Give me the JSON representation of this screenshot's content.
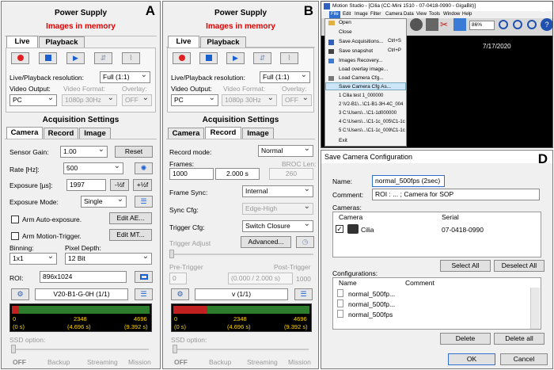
{
  "labels": {
    "a": "A",
    "b": "B",
    "c": "C",
    "d": "D"
  },
  "panel_a": {
    "title": "Power Supply",
    "images_in_memory": "Images in memory",
    "tabs": [
      "Live",
      "Playback"
    ],
    "live_playback_res_label": "Live/Playback resolution:",
    "live_playback_res": "Full (1:1)",
    "video_output_label": "Video Output:",
    "video_output": "PC",
    "video_format_label": "Video Format:",
    "video_format": "1080p 30Hz",
    "overlay_label": "Overlay:",
    "overlay": "OFF",
    "acq_title": "Acquisition Settings",
    "acq_tabs": [
      "Camera",
      "Record",
      "Image"
    ],
    "sensor_gain_label": "Sensor Gain:",
    "sensor_gain": "1.00",
    "reset": "Reset",
    "rate_label": "Rate [Hz]:",
    "rate": "500",
    "exposure_label": "Exposure [µs]:",
    "exposure": "1997",
    "half": "-½f",
    "plus_half": "+½f",
    "exposure_mode_label": "Exposure Mode:",
    "exposure_mode": "Single",
    "arm_auto": "Arm Auto-exposure.",
    "edit_ae": "Edit AE...",
    "arm_motion": "Arm Motion-Trigger.",
    "edit_mt": "Edit MT...",
    "binning_label": "Binning:",
    "binning": "1x1",
    "pixel_depth_label": "Pixel Depth:",
    "pixel_depth": "12 Bit",
    "roi_label": "ROI:",
    "roi": "896x1024",
    "camera_id": "V20-B1-G-0H (1/1)",
    "mem": {
      "start": "0",
      "mid": "2348",
      "end": "4696",
      "start_s": "(0 s)",
      "mid_s": "(4.696 s)",
      "end_s": "(9.392 s)",
      "fill": 0.05
    },
    "ssd_label": "SSD option:",
    "ssd_opts": [
      "OFF",
      "Backup",
      "Streaming",
      "Mission"
    ]
  },
  "panel_b": {
    "title": "Power Supply",
    "images_in_memory": "Images in memory",
    "tabs": [
      "Live",
      "Playback"
    ],
    "live_playback_res_label": "Live/Playback resolution:",
    "live_playback_res": "Full (1:1)",
    "video_output_label": "Video Output:",
    "video_output": "PC",
    "video_format_label": "Video Format:",
    "video_format": "1080p 30Hz",
    "overlay_label": "Overlay:",
    "overlay": "OFF",
    "acq_title": "Acquisition Settings",
    "acq_tabs": [
      "Camera",
      "Record",
      "Image"
    ],
    "record_mode_label": "Record mode:",
    "record_mode": "Normal",
    "frames_label": "Frames:",
    "frames": "1000",
    "frames_s": "2.000 s",
    "broc_label": "BROC Len:",
    "broc": "260",
    "frame_sync_label": "Frame Sync:",
    "frame_sync": "Internal",
    "sync_cfg_label": "Sync Cfg:",
    "sync_cfg": "Edge-High",
    "trigger_cfg_label": "Trigger Cfg:",
    "trigger_cfg": "Switch Closure",
    "trigger_adjust": "Trigger Adjust",
    "advanced": "Advanced...",
    "pre_trigger": "Pre-Trigger",
    "post_trigger": "Post-Trigger",
    "pre_val": "0",
    "range": "(0.000 / 2.000 s)",
    "post_val": "1000",
    "camera_id": "v (1/1)",
    "mem": {
      "start": "0",
      "mid": "2348",
      "end": "4696",
      "start_s": "(0 s)",
      "mid_s": "(4.696 s)",
      "end_s": "(9.392 s)",
      "fill": 0.25
    },
    "ssd_label": "SSD option:",
    "ssd_opts": [
      "OFF",
      "Backup",
      "Streaming",
      "Mission"
    ]
  },
  "panel_c": {
    "window_title": "Motion Studio - [Cilia (CC-Mini 1510 - 07-0418-0990 - GigaBit)]",
    "menubar": [
      "File",
      "Edit",
      "Image",
      "Filter",
      "Camera",
      "Data",
      "View",
      "Tools",
      "Window",
      "Help"
    ],
    "zoom": "86%",
    "date": "7/17/2020",
    "menu": [
      {
        "label": "Open",
        "shortcut": ""
      },
      {
        "label": "Close",
        "shortcut": ""
      },
      {
        "label": "Save Acquisitions...",
        "shortcut": "Ctrl+S"
      },
      {
        "label": "Save snapshot",
        "shortcut": "Ctrl+P"
      },
      {
        "label": "Images Recovery...",
        "shortcut": ""
      },
      {
        "label": "Load overlay image...",
        "shortcut": ""
      },
      {
        "label": "Load Camera Cfg...",
        "shortcut": ""
      },
      {
        "label": "Save Camera Cfg As...",
        "shortcut": ""
      },
      {
        "label": "1 Cilia test 1_000000",
        "shortcut": ""
      },
      {
        "label": "2 \\V2-B1\\...\\C1-B1-3H-4C_004",
        "shortcut": ""
      },
      {
        "label": "3 C:\\Users\\...\\C1-1d000000",
        "shortcut": ""
      },
      {
        "label": "4 C:\\Users\\...\\C1-1c_005\\C1-1c",
        "shortcut": ""
      },
      {
        "label": "5 C:\\Users\\...\\C1-1c_009\\C1-1c",
        "shortcut": ""
      },
      {
        "label": "Exit",
        "shortcut": ""
      }
    ]
  },
  "panel_d": {
    "title": "Save Camera Configuration",
    "name_label": "Name:",
    "name": "normal_500fps (2sec)",
    "comment_label": "Comment:",
    "comment": "ROI : ... ; Camera for SOP",
    "cameras_label": "Cameras:",
    "cam_cols": [
      "Camera",
      "Serial"
    ],
    "cam_row": {
      "name": "Cilia",
      "serial": "07-0418-0990"
    },
    "select_all": "Select All",
    "deselect_all": "Deselect All",
    "configs_label": "Configurations:",
    "cfg_cols": [
      "Name",
      "Comment"
    ],
    "configs": [
      "normal_500fp...",
      "normal_500fp...",
      "normal_500fps"
    ],
    "delete": "Delete",
    "delete_all": "Delete all",
    "ok": "OK",
    "cancel": "Cancel"
  }
}
